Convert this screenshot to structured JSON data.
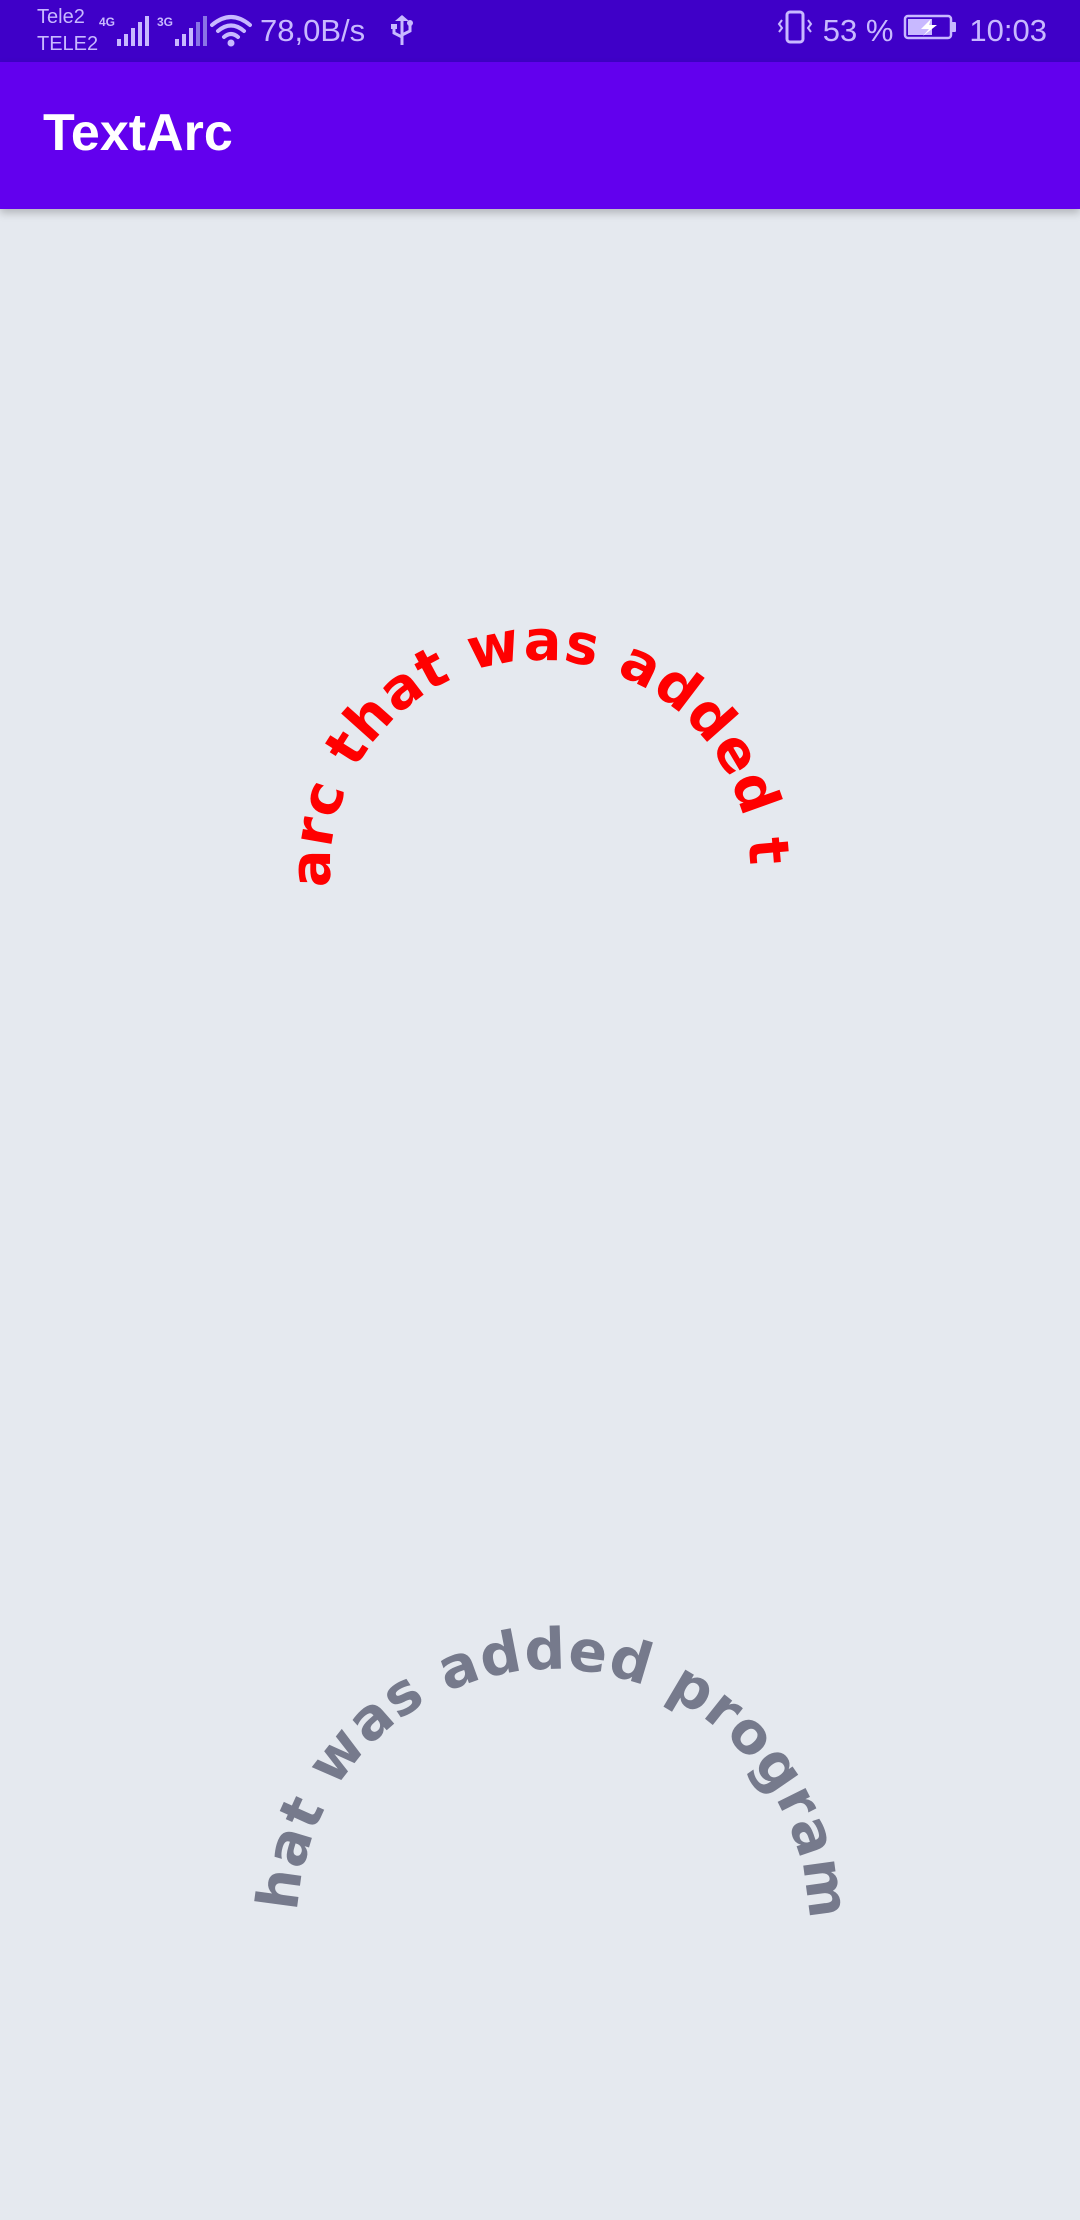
{
  "status_bar": {
    "carrier_1": "Tele2",
    "carrier_2": "TELE2",
    "network_1": "4G",
    "network_2": "3G",
    "speed": "78,0B/s",
    "battery": "53 %",
    "time": "10:03"
  },
  "app_bar": {
    "title": "TextArc"
  },
  "arcs": {
    "xml_text": "Text arc that was added to xml",
    "xml_color": "#ff0000",
    "programmatic_text": "Text arc that was added programmatically",
    "programmatic_color": "#767a8c"
  },
  "colors": {
    "status_bar": "#3f00c8",
    "app_bar": "#6200ee",
    "background": "#e5e9ef"
  }
}
